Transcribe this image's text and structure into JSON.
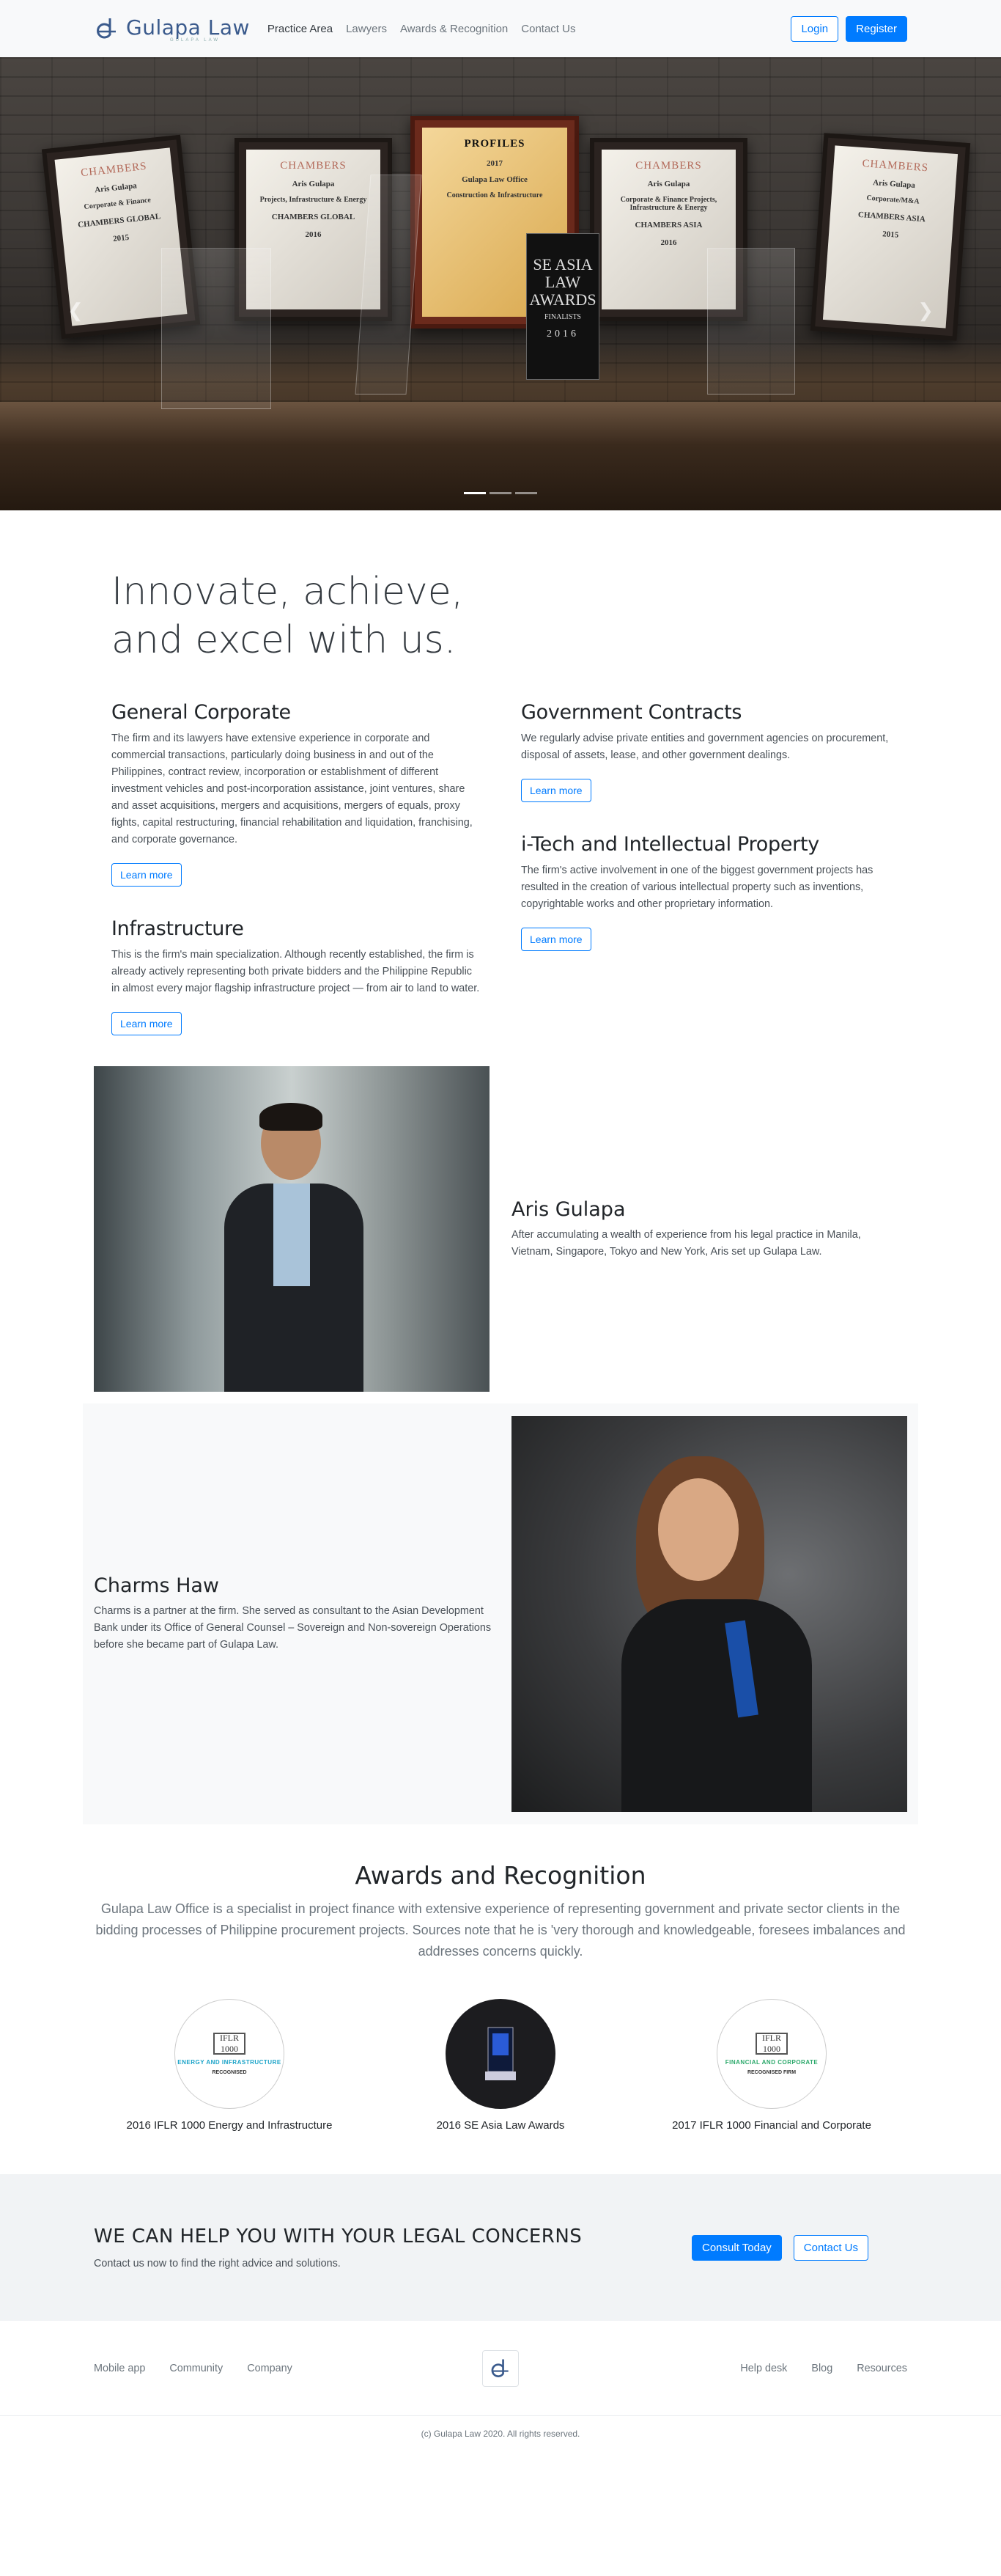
{
  "brand": {
    "name": "Gulapa Law",
    "tagline": "GULAPA LAW"
  },
  "nav": {
    "links": [
      "Practice Area",
      "Lawyers",
      "Awards & Recognition",
      "Contact Us"
    ],
    "login": "Login",
    "register": "Register"
  },
  "hero": {
    "plaques": [
      {
        "title": "CHAMBERS",
        "name": "Aris Gulapa",
        "line": "Corporate & Finance",
        "footer": "CHAMBERS GLOBAL",
        "year": "2015"
      },
      {
        "title": "CHAMBERS",
        "name": "Aris Gulapa",
        "line": "Projects, Infrastructure & Energy",
        "footer": "CHAMBERS GLOBAL",
        "year": "2016"
      },
      {
        "title": "PROFILES",
        "name": "Gulapa Law Office",
        "line": "Construction & Infrastructure",
        "footer": "",
        "year": "2017"
      },
      {
        "title": "CHAMBERS",
        "name": "Aris Gulapa",
        "line": "Corporate & Finance Projects, Infrastructure & Energy",
        "footer": "CHAMBERS ASIA",
        "year": "2016"
      },
      {
        "title": "CHAMBERS",
        "name": "Aris Gulapa",
        "line": "Corporate/M&A",
        "footer": "CHAMBERS ASIA",
        "year": "2015"
      }
    ],
    "trophy": {
      "title": "SE ASIA LAW AWARDS",
      "sub": "FINALISTS",
      "year": "2016"
    },
    "prev_icon": "chevron-left-icon",
    "next_icon": "chevron-right-icon"
  },
  "intro": {
    "title_line1": "Innovate, achieve,",
    "title_line2": "and excel with us."
  },
  "practice_areas": {
    "left": [
      {
        "title": "General Corporate",
        "body": "The firm and its lawyers have extensive experience in corporate and commercial transactions, particularly doing business in and out of the Philippines, contract review, incorporation or establishment of different investment vehicles and post-incorporation assistance, joint ventures, share and asset acquisitions, mergers and acquisitions, mergers of equals, proxy fights, capital restructuring, financial rehabilitation and liquidation, franchising, and corporate governance.",
        "button": "Learn more"
      },
      {
        "title": "Infrastructure",
        "body": "This is the firm's main specialization. Although recently established, the firm is already actively representing both private bidders and the Philippine Republic in almost every major flagship infrastructure project — from air to land to water.",
        "button": "Learn more"
      }
    ],
    "right": [
      {
        "title": "Government Contracts",
        "body": "We regularly advise private entities and government agencies on procurement, disposal of assets, lease, and other government dealings.",
        "button": "Learn more"
      },
      {
        "title": "i-Tech and Intellectual Property",
        "body": "The firm's active involvement in one of the biggest government projects has resulted in the creation of various intellectual property such as inventions, copyrightable works and other proprietary information.",
        "button": "Learn more"
      }
    ]
  },
  "lawyers": [
    {
      "name": "Aris Gulapa",
      "bio": "After accumulating a wealth of experience from his legal practice in Manila, Vietnam, Singapore, Tokyo and New York, Aris set up Gulapa Law."
    },
    {
      "name": "Charms Haw",
      "bio": "Charms is a partner at the firm. She served as consultant to the Asian Development Bank under its Office of General Counsel – Sovereign and Non-sovereign Operations before she became part of Gulapa Law."
    }
  ],
  "awards": {
    "title": "Awards and Recognition",
    "lead": "Gulapa Law Office is a specialist in project finance with extensive experience of representing government and private sector clients in the bidding processes of Philippine procurement projects. Sources note that he is 'very thorough and knowledgeable, foresees imbalances and addresses concerns quickly.",
    "items": [
      {
        "caption": "2016 IFLR 1000 Energy and Infrastructure",
        "badge_logo": "IFLR 1000",
        "badge_line": "ENERGY AND INFRASTRUCTURE",
        "badge_sub": "RECOGNISED"
      },
      {
        "caption": "2016 SE Asia Law Awards",
        "badge_logo": "",
        "badge_line": "",
        "badge_sub": ""
      },
      {
        "caption": "2017 IFLR 1000 Financial and Corporate",
        "badge_logo": "IFLR 1000",
        "badge_line": "FINANCIAL AND CORPORATE",
        "badge_sub": "RECOGNISED FIRM"
      }
    ]
  },
  "cta": {
    "title": "WE CAN HELP YOU WITH YOUR LEGAL CONCERNS",
    "subtitle": "Contact us now to find the right advice and solutions.",
    "primary": "Consult Today",
    "secondary": "Contact Us"
  },
  "footer": {
    "left_links": [
      "Mobile app",
      "Community",
      "Company"
    ],
    "right_links": [
      "Help desk",
      "Blog",
      "Resources"
    ],
    "copyright": "(c) Gulapa Law 2020. All rights reserved."
  },
  "colors": {
    "primary": "#007bff",
    "brand": "#3a5a8c",
    "light": "#f8f9fa"
  }
}
